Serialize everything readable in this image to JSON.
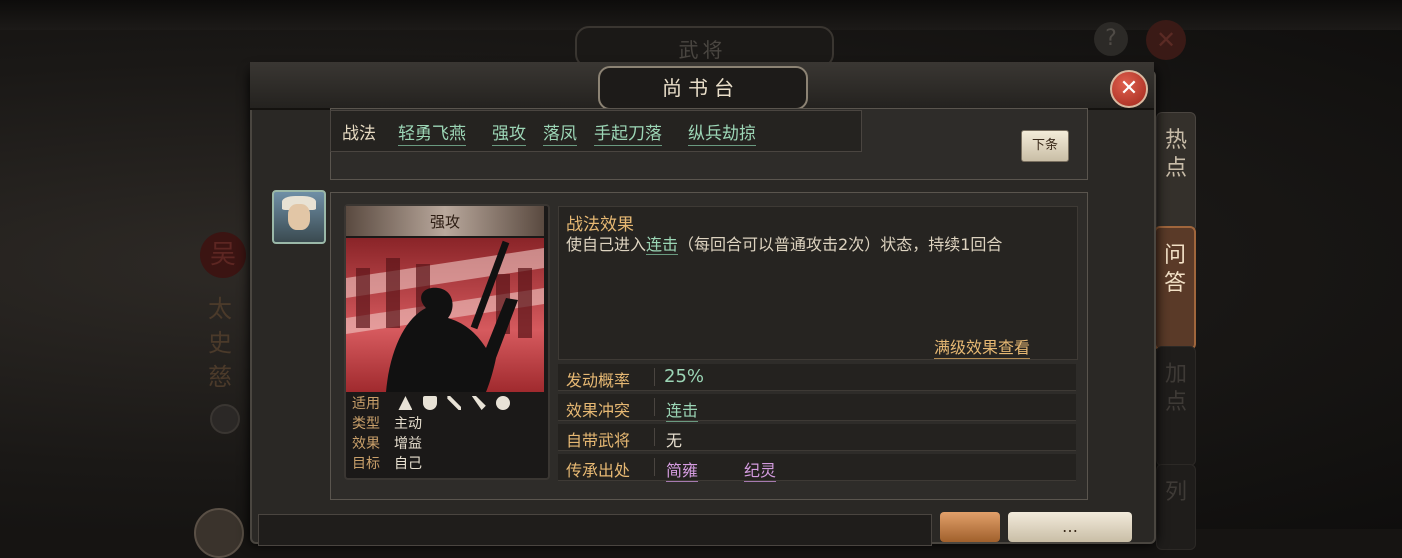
{
  "background": {
    "title": "武将",
    "help_label": "?",
    "close_label": "✕",
    "faction": "吴",
    "general_name": "太史慈"
  },
  "side_tabs": [
    {
      "label": "热\n点",
      "active": false
    },
    {
      "label": "问\n答",
      "active": true
    },
    {
      "label": "加\n点",
      "active": false
    },
    {
      "label": "列",
      "active": false
    }
  ],
  "dialog": {
    "title": "尚书台",
    "close_label": "✕"
  },
  "tactics_bar": {
    "label": "战法",
    "links": [
      "轻勇飞燕",
      "强攻",
      "落凤",
      "手起刀落",
      "纵兵劫掠"
    ],
    "next_button": "下条"
  },
  "card": {
    "name": "强攻",
    "info": [
      {
        "key": "适用",
        "value": ""
      },
      {
        "key": "类型",
        "value": "主动"
      },
      {
        "key": "效果",
        "value": "增益"
      },
      {
        "key": "目标",
        "value": "自己"
      }
    ],
    "troop_icons": [
      "cavalry-icon",
      "shield-icon",
      "bow-icon",
      "spear-icon",
      "siege-icon"
    ]
  },
  "effect": {
    "title": "战法效果",
    "text_before": "使自己进入",
    "highlight": "连击",
    "text_after": "（每回合可以普通攻击2次）状态，持续1回合",
    "max_level_link": "满级效果查看"
  },
  "rows": [
    {
      "key": "发动概率",
      "value": "25%"
    },
    {
      "key": "效果冲突",
      "value": "连击"
    },
    {
      "key": "自带武将",
      "value": "无"
    },
    {
      "key": "传承出处",
      "values": [
        "简雍",
        "纪灵"
      ]
    }
  ],
  "bottom": {
    "button2_label": "…"
  },
  "colors": {
    "accent_gold": "#e6b873",
    "link_green": "#9cd6b6",
    "link_purple": "#d59ce0",
    "close_red": "#c0392b"
  }
}
